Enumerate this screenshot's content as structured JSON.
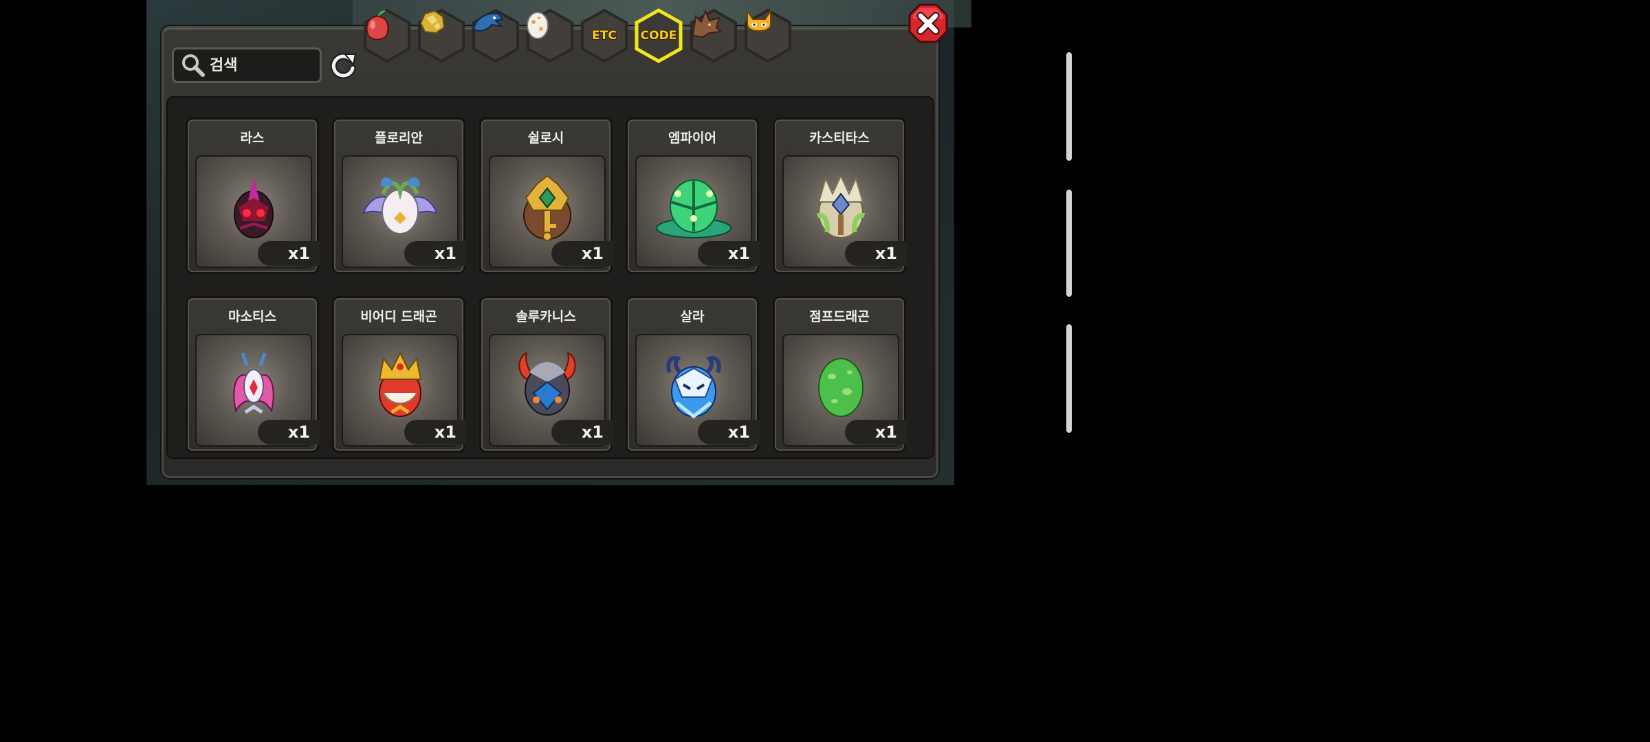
{
  "search": {
    "placeholder": "검색"
  },
  "tabs": [
    {
      "name": "fruit",
      "icon": "red-fruit-icon"
    },
    {
      "name": "gold",
      "icon": "gold-nugget-icon"
    },
    {
      "name": "dragon-head",
      "icon": "blue-dragon-icon"
    },
    {
      "name": "egg",
      "icon": "spotted-egg-icon"
    },
    {
      "name": "etc",
      "label": "ETC"
    },
    {
      "name": "code",
      "label": "CODE",
      "selected": true
    },
    {
      "name": "wolf",
      "icon": "wolf-head-icon"
    },
    {
      "name": "cat",
      "icon": "horned-cat-icon"
    }
  ],
  "items": [
    {
      "name": "라스",
      "qty": "x1",
      "icon": "dark-spiked-egg-icon"
    },
    {
      "name": "플로리안",
      "qty": "x1",
      "icon": "winged-white-egg-icon"
    },
    {
      "name": "쉴로시",
      "qty": "x1",
      "icon": "golden-key-egg-icon"
    },
    {
      "name": "엠파이어",
      "qty": "x1",
      "icon": "green-slime-egg-icon"
    },
    {
      "name": "카스티타스",
      "qty": "x1",
      "icon": "crystal-crowned-egg-icon"
    },
    {
      "name": "마소티스",
      "qty": "x1",
      "icon": "pink-winged-egg-icon"
    },
    {
      "name": "비어디 드래곤",
      "qty": "x1",
      "icon": "crowned-red-egg-icon"
    },
    {
      "name": "솔루카니스",
      "qty": "x1",
      "icon": "flame-horned-egg-icon"
    },
    {
      "name": "살라",
      "qty": "x1",
      "icon": "blue-frost-egg-icon"
    },
    {
      "name": "점프드래곤",
      "qty": "x1",
      "icon": "green-spotted-egg-icon"
    }
  ],
  "colors": {
    "selected_tab_border": "#f2e61a",
    "tab_text": "#f6c92b",
    "close": "#d8262b"
  }
}
